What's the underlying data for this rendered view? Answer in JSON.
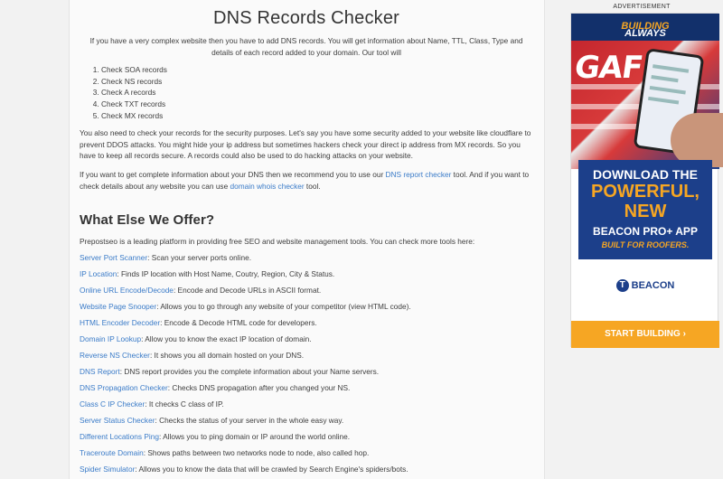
{
  "page": {
    "title": "DNS Records Checker",
    "intro": "If you have a very complex website then you have to add DNS records. You will get information about Name, TTL, Class, Type and details of each record added to your domain. Our tool will",
    "checks": [
      "Check SOA records",
      "Check NS records",
      "Check A records",
      "Check TXT records",
      "Check MX records"
    ],
    "para1": "You also need to check your records for the security purposes. Let's say you have some security added to your website like cloudflare to prevent DDOS attacks. You might hide your ip address but sometimes hackers check your direct ip address from MX records. So you have to keep all records secure. A records could also be used to do hacking attacks on your website.",
    "para2": {
      "t1": "If you want to get complete information about your DNS then we recommend you to use our ",
      "link1": "DNS report checker",
      "t2": " tool. And if you want to check details about any website you can use ",
      "link2": "domain whois checker",
      "t3": " tool."
    }
  },
  "offer": {
    "heading": "What Else We Offer?",
    "intro": "Prepostseo is a leading platform in providing free SEO and website management tools. You can check more tools here:",
    "tools": [
      {
        "name": "Server Port Scanner",
        "desc": ": Scan your server ports online."
      },
      {
        "name": "IP Location",
        "desc": ": Finds IP location with Host Name, Coutry, Region, City & Status."
      },
      {
        "name": "Online URL Encode/Decode",
        "desc": ": Encode and Decode URLs in ASCII format."
      },
      {
        "name": "Website Page Snooper",
        "desc": ": Allows you to go through any website of your competitor (view HTML code)."
      },
      {
        "name": "HTML Encoder Decoder",
        "desc": ": Encode & Decode HTML code for developers."
      },
      {
        "name": "Domain IP Lookup",
        "desc": ": Allow you to know the exact IP location of domain."
      },
      {
        "name": "Reverse NS Checker",
        "desc": ": It shows you all domain hosted on your DNS."
      },
      {
        "name": "DNS Report",
        "desc": ": DNS report provides you the complete information about your Name servers."
      },
      {
        "name": "DNS Propagation Checker",
        "desc": ": Checks DNS propagation after you changed your NS."
      },
      {
        "name": "Class C IP Checker",
        "desc": ": It checks C class of IP."
      },
      {
        "name": "Server Status Checker",
        "desc": ": Checks the status of your server in the whole easy way."
      },
      {
        "name": "Different Locations Ping",
        "desc": ": Allows you to ping domain or IP around the world online."
      },
      {
        "name": "Traceroute Domain",
        "desc": ": Shows paths between two networks node to node, also called hop."
      },
      {
        "name": "Spider Simulator",
        "desc": ": Allows you to know the data that will be crawled by Search Engine's spiders/bots."
      }
    ]
  },
  "ad": {
    "label": "ADVERTISEMENT",
    "top_a": "ALWAYS ",
    "top_b": "BUILDING",
    "photo_logo": "GAF",
    "line1": "DOWNLOAD THE",
    "line2": "POWERFUL,",
    "line3": "NEW",
    "line4": "BEACON PRO+ APP",
    "line5": "BUILT FOR ROOFERS.",
    "brand": "BEACON",
    "brand_glyph": "T",
    "cta": "START BUILDING ›"
  },
  "colors": {
    "link": "#3a7bc8",
    "ad_blue": "#1c3f8a",
    "ad_orange": "#f6a623"
  }
}
